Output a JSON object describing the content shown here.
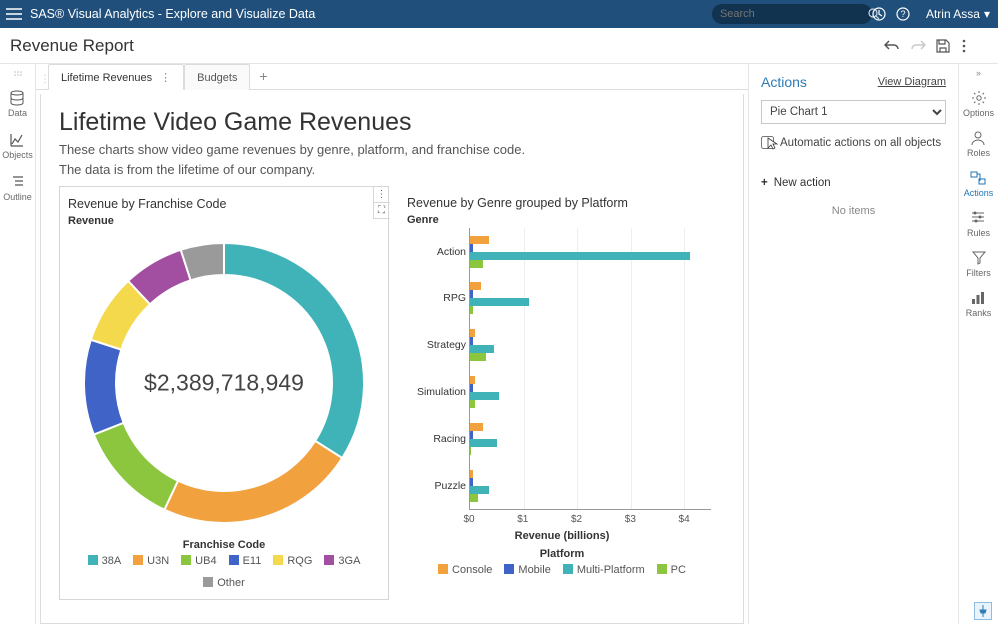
{
  "app": {
    "title": "SAS® Visual Analytics - Explore and Visualize Data"
  },
  "search": {
    "placeholder": "Search"
  },
  "user": {
    "name": "Atrin Assa"
  },
  "report": {
    "title": "Revenue Report"
  },
  "leftrail": {
    "data": "Data",
    "objects": "Objects",
    "outline": "Outline"
  },
  "tabs": {
    "active": "Lifetime Revenues",
    "other": "Budgets"
  },
  "page": {
    "heading": "Lifetime Video Game Revenues",
    "sub1": "These charts show video game revenues by genre, platform, and franchise code.",
    "sub2": "The data is from the lifetime of our company."
  },
  "pie": {
    "title": "Revenue by Franchise Code",
    "axis": "Revenue",
    "center": "$2,389,718,949",
    "legendtitle": "Franchise Code",
    "items": [
      {
        "label": "38A",
        "color": "#3fb3b8"
      },
      {
        "label": "U3N",
        "color": "#f2a13f"
      },
      {
        "label": "UB4",
        "color": "#8cc63f"
      },
      {
        "label": "E11",
        "color": "#3f63c6"
      },
      {
        "label": "RQG",
        "color": "#f5d94d"
      },
      {
        "label": "3GA",
        "color": "#a24fa2"
      },
      {
        "label": "Other",
        "color": "#9a9a9a"
      }
    ]
  },
  "bar": {
    "title": "Revenue by Genre grouped by Platform",
    "yaxis": "Genre",
    "xaxis": "Revenue (billions)",
    "legendtitle": "Platform",
    "ticks": [
      "$0",
      "$1",
      "$2",
      "$3",
      "$4"
    ],
    "platforms": [
      {
        "label": "Console",
        "color": "#f2a13f"
      },
      {
        "label": "Mobile",
        "color": "#3f63c6"
      },
      {
        "label": "Multi-Platform",
        "color": "#3fb3b8"
      },
      {
        "label": "PC",
        "color": "#8cc63f"
      }
    ]
  },
  "actions": {
    "header": "Actions",
    "viewdiagram": "View Diagram",
    "select": "Pie Chart 1",
    "checkbox": "Automatic actions on all objects",
    "newaction": "New action",
    "noitems": "No items"
  },
  "rightrail": {
    "options": "Options",
    "roles": "Roles",
    "actions": "Actions",
    "rules": "Rules",
    "filters": "Filters",
    "ranks": "Ranks"
  },
  "chart_data": [
    {
      "type": "pie",
      "title": "Revenue by Franchise Code",
      "center_total": 2389718949,
      "series": [
        {
          "name": "38A",
          "pct": 34,
          "color": "#3fb3b8"
        },
        {
          "name": "U3N",
          "pct": 23,
          "color": "#f2a13f"
        },
        {
          "name": "UB4",
          "pct": 12,
          "color": "#8cc63f"
        },
        {
          "name": "E11",
          "pct": 11,
          "color": "#3f63c6"
        },
        {
          "name": "RQG",
          "pct": 8,
          "color": "#f5d94d"
        },
        {
          "name": "3GA",
          "pct": 7,
          "color": "#a24fa2"
        },
        {
          "name": "Other",
          "pct": 5,
          "color": "#9a9a9a"
        }
      ]
    },
    {
      "type": "bar",
      "orientation": "horizontal-grouped",
      "title": "Revenue by Genre grouped by Platform",
      "xlabel": "Revenue (billions)",
      "ylabel": "Genre",
      "xlim": [
        0,
        4.5
      ],
      "categories": [
        "Action",
        "RPG",
        "Strategy",
        "Simulation",
        "Racing",
        "Puzzle"
      ],
      "series": [
        {
          "name": "Console",
          "color": "#f2a13f",
          "values": [
            0.35,
            0.2,
            0.1,
            0.1,
            0.25,
            0.05
          ]
        },
        {
          "name": "Mobile",
          "color": "#3f63c6",
          "values": [
            0.05,
            0.05,
            0.05,
            0.05,
            0.05,
            0.05
          ]
        },
        {
          "name": "Multi-Platform",
          "color": "#3fb3b8",
          "values": [
            4.1,
            1.1,
            0.45,
            0.55,
            0.5,
            0.35
          ]
        },
        {
          "name": "PC",
          "color": "#8cc63f",
          "values": [
            0.25,
            0.05,
            0.3,
            0.1,
            0.02,
            0.15
          ]
        }
      ]
    }
  ]
}
